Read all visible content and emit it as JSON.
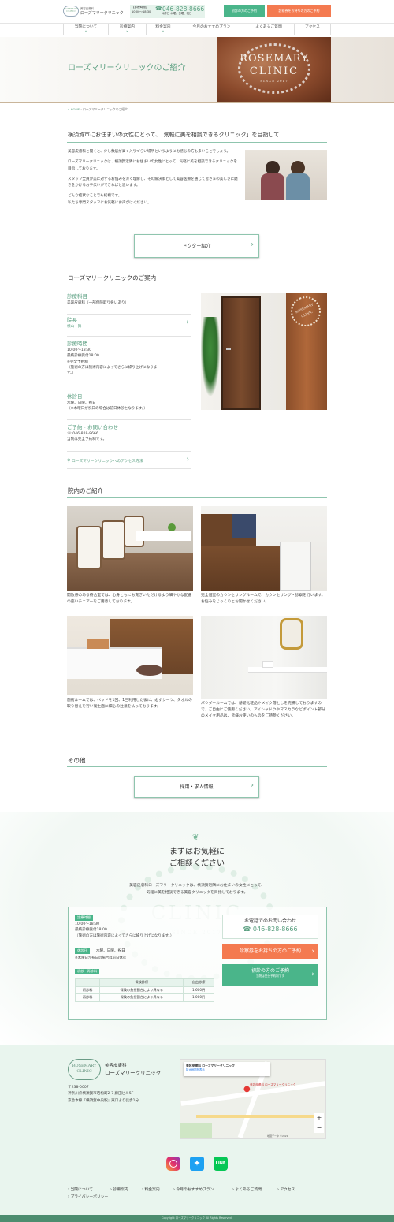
{
  "header": {
    "logo_top": "ROSEMARY",
    "logo_bottom": "CLINIC",
    "clinic_small": "美容皮膚科",
    "clinic_name": "ローズマリークリニック",
    "hours_label": "【診療時間】",
    "hours_value": "10:00〜18:30",
    "phone": "046-828-8666",
    "closed": "休診日 木曜、日曜、祝日",
    "btn_first": "初診の方のご予約",
    "btn_ticket": "診察券をお持ちの方のご予約"
  },
  "nav": [
    "当院について",
    "診療案内",
    "料金案内",
    "今月のおすすめプラン",
    "よくあるご質問",
    "アクセス"
  ],
  "hero": {
    "title": "ローズマリークリニックのご紹介",
    "sign_top": "ROSEMARY",
    "sign_bottom": "CLINIC",
    "sign_since": "SINCE 2017"
  },
  "breadcrumb": {
    "home": "HOME",
    "current": "ローズマリークリニックのご紹介"
  },
  "intro": {
    "heading": "横須賀市にお住まいの女性にとって、「気軽に美を相談できるクリニック」を目指して",
    "p1": "美容皮膚科と聞くと、少し敷居が高く入りづらい場所というようにお感じの方も多いことでしょう。",
    "p2": "ローズマリークリニックは、横須賀近隣にお住まいの女性にとって、気軽に美を相談できるクリニックを目指しております。",
    "p3": "スタッフ全員が美に対するお悩みを深く理解し、その解決策として美容医療を通じて皆さまの美しさに磨きをかけるお手伝いができればと思います。",
    "p4": "どんな症状なことでも結構です。",
    "p5": "私たち専門スタッフにお気軽にお声がけください。",
    "doctor_btn": "ドクター紹介"
  },
  "guide": {
    "heading": "ローズマリークリニックのご案内",
    "rows": [
      {
        "title": "診療科目",
        "lines": [
          "美容皮膚科（一部保険取り扱いあり）"
        ]
      },
      {
        "title": "院長",
        "lines": [
          "横山　舞"
        ]
      },
      {
        "title": "診療時間",
        "lines": [
          "10:00〜18:30",
          "最終診療受付18:00",
          "※完全予約制",
          "（施術の方は施術内容によってさらに繰り上げになりま",
          "す。）"
        ]
      },
      {
        "title": "休診日",
        "lines": [
          "木曜、日曜、祝日",
          "（※木曜日が祝日の場合は前日休診となります。）"
        ]
      },
      {
        "title": "ご予約・お問い合わせ",
        "lines": [
          "046-828-8666",
          "当院は完全予約制です。"
        ]
      }
    ],
    "access": "ローズマリークリニックへのアクセス方法",
    "door_sign": "ROSEMARY CLINIC"
  },
  "inside": {
    "heading": "院内のご紹介",
    "captions": [
      "開放感のある待合室では、心身ともにお寛ぎいただけるよう細やかな配慮の座いチェアーをご用意しております。",
      "完全個室のカウンセリングルームで、カウンセリング・診察を行います。お悩みをじっくりとお聞かせください。",
      "施術ルームでは、ベッドを1回、1回利用した後に、必ずシーツ、タオルの取り替えを行い衛生面に細心の注意を払っております。",
      "パウダールームでは、基礎化粧品やメイク落としを完備しておりますので、ご自由にご使用ください。アイシャドウやマスカラなどポイント部分のメイク用品は、皆様お使いのものをご持参ください。"
    ]
  },
  "other": {
    "heading": "その他",
    "recruit_btn": "採用・求人情報"
  },
  "contact": {
    "title1": "まずはお気軽に",
    "title2": "ご相談ください",
    "lead1": "美容皮膚科ローズマリークリニックは、横須賀近隣にお住まいの女性にとって、",
    "lead2": "気軽に美を相談できる美容クリニックを目指しております。",
    "watermark": "CLINIC",
    "since": "SINCE 2017",
    "hours_badge": "診療時間",
    "hours1": "10:00〜18:30",
    "hours2": "最終診療受付18:00",
    "hours3": "（施術の方は施術内容によってさらに繰り上げになります。）",
    "closed_badge": "休診日",
    "closed_value": "木曜、日曜、祝日",
    "closed_note": "※木曜日が祝日の場合は前日休診",
    "fee_badge": "初診・再診料",
    "fee_head": [
      "",
      "保険診療",
      "自由診療"
    ],
    "fee_rows": [
      [
        "初診料",
        "保険の負担割合により異なる",
        "1,600円"
      ],
      [
        "再診料",
        "保険の負担割合により異なる",
        "1,000円"
      ]
    ],
    "phone_title": "お電話でのお問い合わせ",
    "phone": "046-828-8666",
    "btn_ticket": "診察券をお持ちの方のご予約",
    "btn_first": "初診の方のご予約",
    "btn_first_sub": "当院は完全予約制です"
  },
  "footer": {
    "logo_top": "ROSEMARY",
    "logo_bottom": "CLINIC",
    "clinic_small": "美容皮膚科",
    "clinic_name": "ローズマリークリニック",
    "zip": "〒238-0007",
    "addr1": "神奈川県横須賀市若松町2-7 藤田ビル5F",
    "addr2": "京急本線『横須賀中央駅』東口より徒歩1分",
    "map_title": "美容皮膚科 ローズマリークリニック",
    "map_link": "拡大地図を表示",
    "map_pin": "美容皮膚科 ローズマリークリニック",
    "map_credit": "地図データ ©2021",
    "links": [
      "当院について",
      "診療案内",
      "料金案内",
      "今月のおすすめプラン",
      "よくあるご質問",
      "アクセス",
      "プライバシーポリシー"
    ],
    "copyright": "Copyright ローズマリークリニック All Rights Reserved."
  },
  "colors": {
    "green": "#5a9f80",
    "button_green": "#4ab58a",
    "button_orange": "#f47a50",
    "footer_bg": "#e9f5ee",
    "copyright_bg": "#4d8d6f"
  }
}
